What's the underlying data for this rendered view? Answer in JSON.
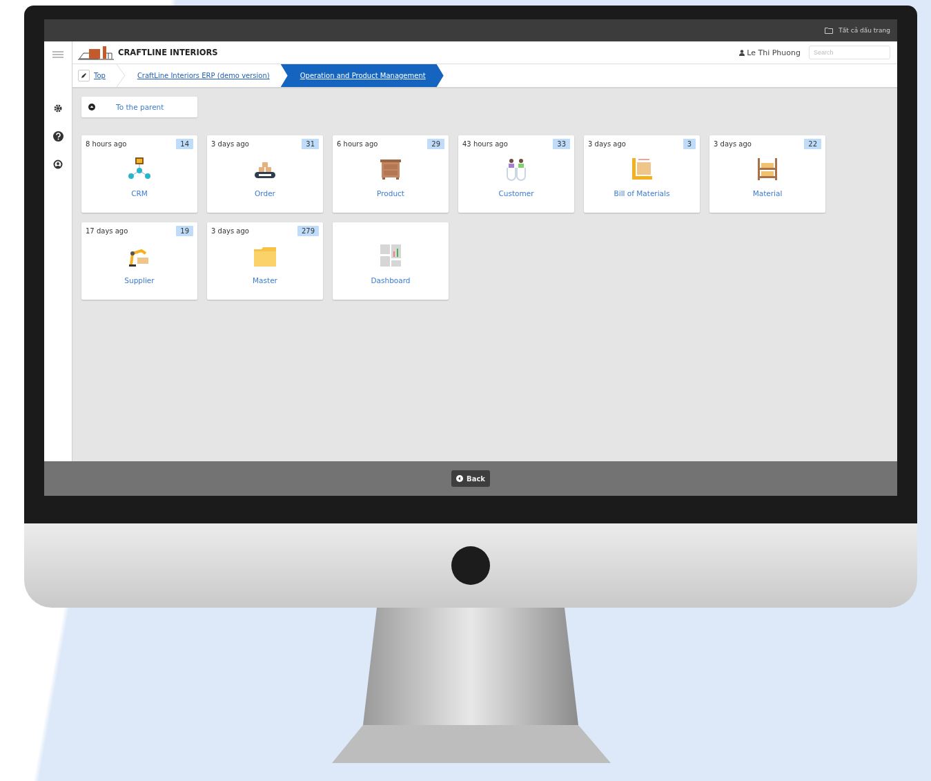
{
  "browser_bar": {
    "bookmarks": "Tất cả dấu trang"
  },
  "header": {
    "brand": "CRAFTLINE INTERIORS",
    "user": "Le Thi Phuong",
    "search": {
      "placeholder": "Search"
    }
  },
  "breadcrumb": [
    {
      "label": "Top",
      "selected": false
    },
    {
      "label": "CraftLine Interiors ERP (demo version)",
      "selected": false
    },
    {
      "label": "Operation and Product Management",
      "selected": true
    }
  ],
  "parent_button": "To the parent",
  "tiles": [
    {
      "updated": "8 hours ago",
      "count": "14",
      "label": "CRM"
    },
    {
      "updated": "3 days ago",
      "count": "31",
      "label": "Order"
    },
    {
      "updated": "6 hours ago",
      "count": "29",
      "label": "Product"
    },
    {
      "updated": "43 hours ago",
      "count": "33",
      "label": "Customer"
    },
    {
      "updated": "3 days ago",
      "count": "3",
      "label": "Bill of Materials"
    },
    {
      "updated": "3 days ago",
      "count": "22",
      "label": "Material"
    },
    {
      "updated": "17 days ago",
      "count": "19",
      "label": "Supplier"
    },
    {
      "updated": "3 days ago",
      "count": "279",
      "label": "Master"
    },
    {
      "label": "Dashboard"
    }
  ],
  "footer": {
    "back_button": "Back"
  }
}
